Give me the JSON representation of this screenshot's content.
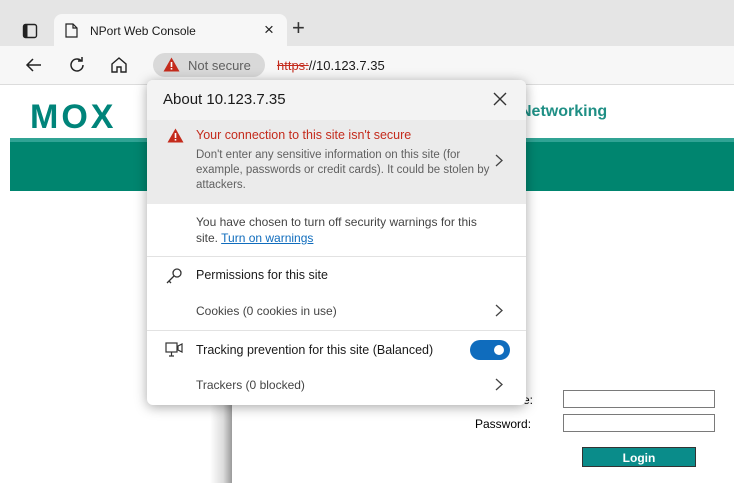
{
  "browser": {
    "tab_title": "NPort Web Console",
    "new_tab_glyph": "+",
    "close_tab_glyph": "×",
    "security_chip": "Not secure",
    "url_scheme": "https:",
    "url_rest": "//10.123.7.35"
  },
  "page": {
    "logo": "MOX",
    "header_fragment": "Networking",
    "username_label_fragment": "e:",
    "password_label": "Password:",
    "login_button": "Login"
  },
  "popup": {
    "title": "About 10.123.7.35",
    "warning_title": "Your connection to this site isn't secure",
    "warning_body": "Don't enter any sensitive information on this site (for example, passwords or credit cards). It could be stolen by attackers.",
    "warnings_off_text": "You have chosen to turn off security warnings for this site.",
    "turn_on_link": "Turn on warnings",
    "permissions_label": "Permissions for this site",
    "cookies_label": "Cookies (0 cookies in use)",
    "tracking_label": "Tracking prevention for this site (Balanced)",
    "tracking_enabled": true,
    "trackers_label": "Trackers (0 blocked)"
  },
  "colors": {
    "accent": "#0f6cbd",
    "danger": "#c42b1c",
    "brand": "#00856f"
  }
}
